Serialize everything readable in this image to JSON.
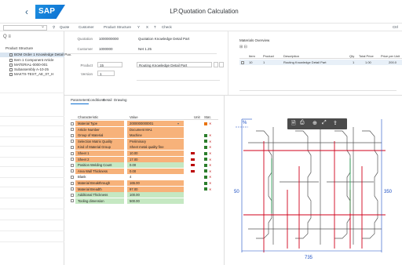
{
  "app": {
    "title": "LP.Quotation Calculation",
    "logo": "SAP",
    "back_icon": "back-arrow-icon"
  },
  "toolbar": {
    "items": [
      "Quote",
      "Customer",
      "Product Structure",
      "Y",
      "X",
      "T",
      "Check"
    ],
    "dropdown_value": "",
    "right_label": "Ctrl"
  },
  "tree": {
    "header_icons": "Q  ≡",
    "title": "Product Structure",
    "items": [
      {
        "label": "BOM Order 1 Knowledge Detail Part",
        "selected": true
      },
      {
        "label": "Item 1 Component Article",
        "selected": false
      },
      {
        "label": "MATERIAL-0000-001",
        "selected": false
      },
      {
        "label": "Subassembly A-10-25",
        "selected": false
      },
      {
        "label": "MAKTX-TEST_AE_07_H",
        "selected": false
      }
    ]
  },
  "header": {
    "labels": [
      "Quotation",
      "Customer",
      "Product",
      "Version"
    ],
    "values": [
      "1000000000",
      "1000000",
      "15",
      "1"
    ],
    "right_values": [
      "Quotation Knowledge Detail Part",
      "Net 1.25"
    ],
    "description": "Routing Knowledge Detail Part"
  },
  "item_table": {
    "title": "Materials Overview",
    "columns": [
      "Item",
      "Product",
      "Description",
      "Qty",
      "Total Price",
      "Price per Unit"
    ],
    "rows": [
      {
        "item": "10",
        "product": "1",
        "desc": "Routing Knowledge Detail Part",
        "qty": "1",
        "total": "1.00",
        "unit": "200.0"
      }
    ]
  },
  "tabs": [
    "Parameters",
    "Conditions",
    "Detail",
    "Drawing"
  ],
  "active_tab": 0,
  "grid": {
    "headers": [
      "Characteristic",
      "Value",
      "Unit",
      "Stat."
    ],
    "rows": [
      {
        "name": "Material Type",
        "value": "2000000000001",
        "color": "orange",
        "chip": "",
        "s1": "#e9730c",
        "s2": "✕",
        "dd": "▾"
      },
      {
        "name": "Article Number",
        "value": "Document MA1",
        "color": "orange",
        "chip": "",
        "s1": "",
        "s2": "",
        "dd": ""
      },
      {
        "name": "Group of Material",
        "value": "Machine",
        "color": "orange",
        "chip": "",
        "s1": "#2b7d2b",
        "s2": "✕",
        "dd": ""
      },
      {
        "name": "Selection Matrix Quality",
        "value": "Preliminary",
        "color": "orange",
        "chip": "",
        "s1": "#2b7d2b",
        "s2": "✕",
        "dd": ""
      },
      {
        "name": "Kind of Material Group",
        "value": "Sheet metal quality fine",
        "color": "orange",
        "chip": "",
        "s1": "#2b7d2b",
        "s2": "✕",
        "dd": ""
      },
      {
        "name": "Sheet 1",
        "value": "10.00",
        "color": "orange",
        "chip": "#bb0000",
        "s1": "#2b7d2b",
        "s2": "✕",
        "dd": ""
      },
      {
        "name": "Sheet 2",
        "value": "17.00",
        "color": "orange",
        "chip": "#bb0000",
        "s1": "#2b7d2b",
        "s2": "✕",
        "dd": ""
      },
      {
        "name": "Position Welding Count",
        "value": "0.00",
        "color": "green",
        "chip": "#bb0000",
        "s1": "#2b7d2b",
        "s2": "✕",
        "dd": ""
      },
      {
        "name": "Area Wall Thickness",
        "value": "0.00",
        "color": "orange",
        "chip": "#bb0000",
        "s1": "#2b7d2b",
        "s2": "✕",
        "dd": ""
      },
      {
        "name": "Blank",
        "value": "4",
        "color": "white",
        "chip": "",
        "s1": "#2b7d2b",
        "s2": "✕",
        "dd": ""
      },
      {
        "name": "Material Breakthrough",
        "value": "165.00",
        "color": "orange",
        "chip": "",
        "s1": "#2b7d2b",
        "s2": "✕",
        "dd": ""
      },
      {
        "name": "Material Breadth",
        "value": "97.00",
        "color": "orange",
        "chip": "",
        "s1": "#2b7d2b",
        "s2": "✕",
        "dd": ""
      },
      {
        "name": "Additional Thickness",
        "value": "100.00",
        "color": "green",
        "chip": "",
        "s1": "",
        "s2": "",
        "dd": ""
      },
      {
        "name": "Tooling dimension",
        "value": "500.00",
        "color": "green",
        "chip": "",
        "s1": "",
        "s2": "",
        "dd": ""
      }
    ]
  },
  "drawing": {
    "dim_left": "50",
    "dim_right": "350",
    "dim_bottom": "735",
    "dim_top": "%",
    "tool_icons": [
      "save-icon",
      "print-icon",
      "zoom-icon",
      "fit-icon"
    ],
    "colors": {
      "red": "#d0021b",
      "blue": "#1c4fc4",
      "green": "#1b9b4b",
      "gray": "#666666"
    }
  }
}
